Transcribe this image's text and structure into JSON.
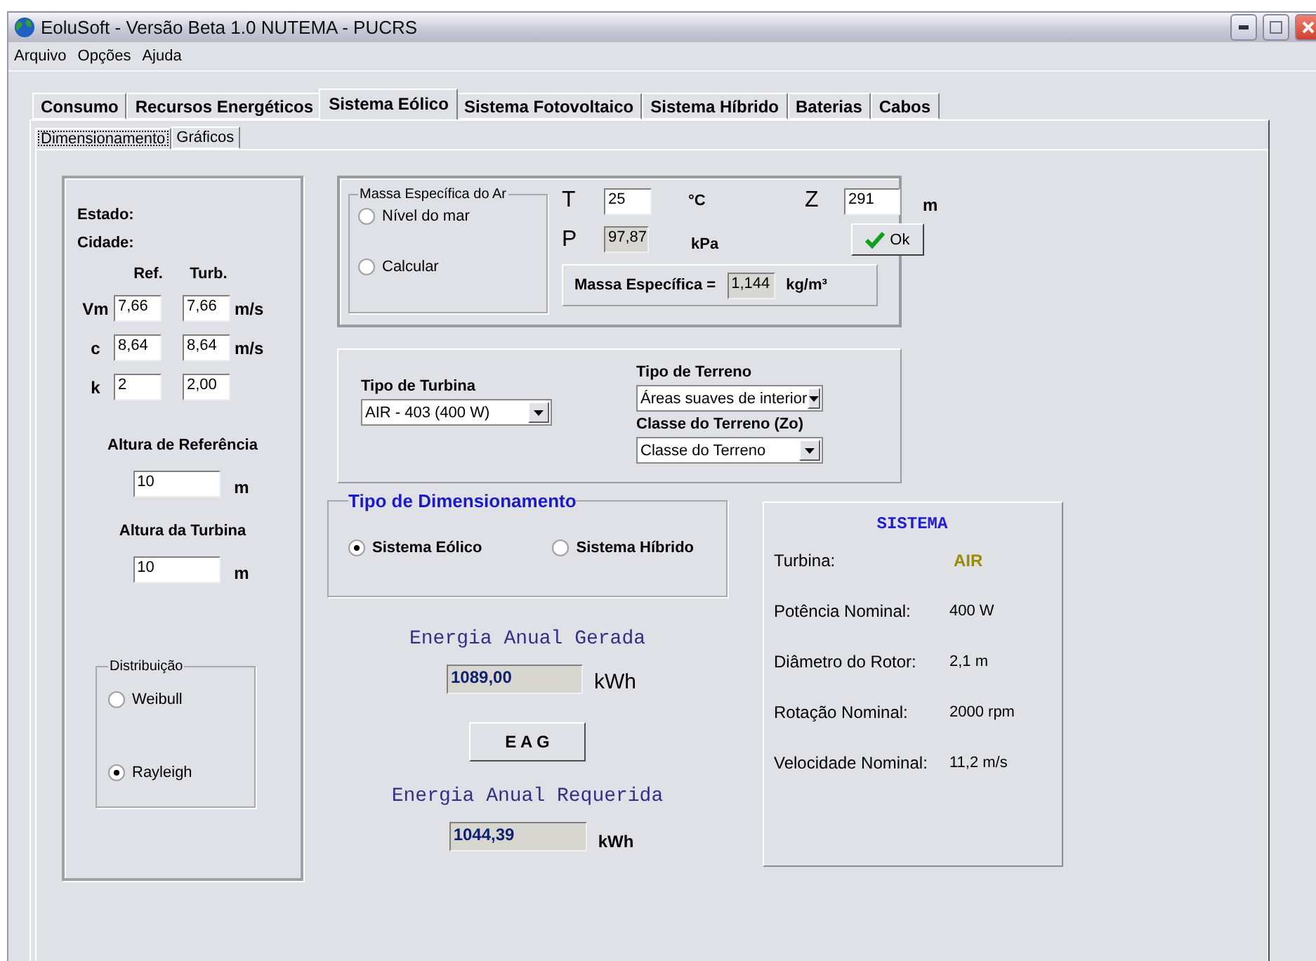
{
  "window": {
    "title": "EoluSoft - Versão Beta 1.0  NUTEMA - PUCRS"
  },
  "menu": [
    "Arquivo",
    "Opções",
    "Ajuda"
  ],
  "tabs": [
    {
      "label": "Consumo",
      "selected": false
    },
    {
      "label": "Recursos Energéticos",
      "selected": false
    },
    {
      "label": "Sistema Eólico",
      "selected": true
    },
    {
      "label": "Sistema Fotovoltaico",
      "selected": false
    },
    {
      "label": "Sistema Híbrido",
      "selected": false
    },
    {
      "label": "Baterias",
      "selected": false
    },
    {
      "label": "Cabos",
      "selected": false
    }
  ],
  "subtabs": [
    {
      "label": "Dimensionamento",
      "selected": true
    },
    {
      "label": "Gráficos",
      "selected": false
    }
  ],
  "left_panel": {
    "estado": "Estado:",
    "cidade": "Cidade:",
    "headers": [
      "Ref.",
      "Turb."
    ],
    "rows": [
      {
        "label": "Vm",
        "ref": "7,66",
        "turb": "7,66",
        "unit": "m/s"
      },
      {
        "label": "c",
        "ref": "8,64",
        "turb": "8,64",
        "unit": "m/s"
      },
      {
        "label": "k",
        "ref": "2",
        "turb": "2,00"
      }
    ],
    "heights": [
      {
        "label": "Altura de Referência",
        "value": "10",
        "unit": "m"
      },
      {
        "label": "Altura da Turbina",
        "value": "10",
        "unit": "m"
      }
    ],
    "distribution": {
      "title": "Distribuição",
      "options": [
        {
          "label": "Weibull",
          "selected": false
        },
        {
          "label": "Rayleigh",
          "selected": true
        }
      ]
    }
  },
  "air": {
    "title": "Massa Específica do Ar",
    "options": [
      {
        "label": "Nível do mar",
        "selected": false
      },
      {
        "label": "Calcular",
        "selected": false
      }
    ],
    "t": {
      "label": "T",
      "value": "25",
      "unit": "°C",
      "disabled": false
    },
    "z": {
      "label": "Z",
      "value": "291",
      "unit": "m",
      "disabled": false
    },
    "p": {
      "label": "P",
      "value": "97,87",
      "unit": "kPa",
      "disabled": true
    },
    "ok_button": "Ok",
    "density": {
      "label": "Massa Específica =",
      "value": "1,144",
      "unit": "kg/m³",
      "disabled": true
    }
  },
  "turbine": {
    "type": {
      "label": "Tipo de Turbina",
      "value": "AIR - 403 (400 W)"
    },
    "terrain": {
      "label": "Tipo de Terreno",
      "value": "Áreas suaves de interior"
    },
    "terrain_class": {
      "label": "Classe do Terreno (Zo)",
      "value": "Classe do Terreno"
    }
  },
  "sizing": {
    "title": "Tipo de Dimensionamento",
    "options": [
      {
        "label": "Sistema Eólico",
        "selected": true
      },
      {
        "label": "Sistema Híbrido",
        "selected": false
      }
    ]
  },
  "energy": {
    "generated": {
      "title": "Energia Anual Gerada",
      "value": "1089,00",
      "unit": "kWh"
    },
    "button": "E A G",
    "required": {
      "title": "Energia Anual Requerida",
      "value": "1044,39",
      "unit": "kWh"
    }
  },
  "system": {
    "title": "SISTEMA",
    "rows": [
      {
        "kind": "name",
        "label": "Turbina:",
        "value": "AIR"
      },
      {
        "kind": "spec",
        "label": "Potência Nominal:",
        "value": "400 W"
      },
      {
        "kind": "spec",
        "label": "Diâmetro do Rotor:",
        "value": "2,1 m"
      },
      {
        "kind": "spec",
        "label": "Rotação Nominal:",
        "value": "2000 rpm"
      },
      {
        "kind": "spec",
        "label": "Velocidade Nominal:",
        "value": "11,2 m/s"
      }
    ]
  }
}
